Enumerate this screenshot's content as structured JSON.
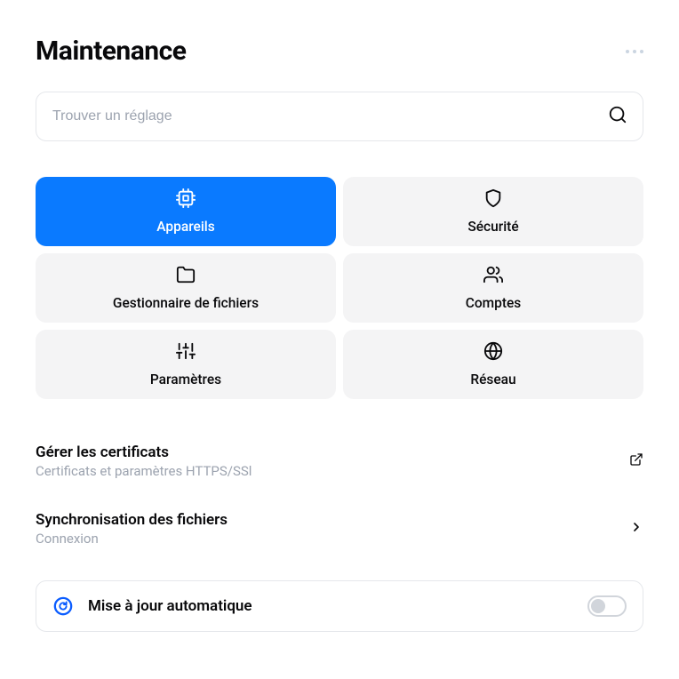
{
  "header": {
    "title": "Maintenance"
  },
  "search": {
    "placeholder": "Trouver un réglage"
  },
  "tiles": [
    {
      "label": "Appareils",
      "icon": "cpu",
      "active": true
    },
    {
      "label": "Sécurité",
      "icon": "shield",
      "active": false
    },
    {
      "label": "Gestionnaire de fichiers",
      "icon": "folder",
      "active": false
    },
    {
      "label": "Comptes",
      "icon": "users",
      "active": false
    },
    {
      "label": "Paramètres",
      "icon": "sliders",
      "active": false
    },
    {
      "label": "Réseau",
      "icon": "globe",
      "active": false
    }
  ],
  "list": [
    {
      "title": "Gérer les certificats",
      "subtitle": "Certificats et paramètres HTTPS/SSl",
      "trailing": "external"
    },
    {
      "title": "Synchronisation des fichiers",
      "subtitle": "Connexion",
      "trailing": "chevron"
    }
  ],
  "update": {
    "label": "Mise à jour automatique",
    "enabled": false
  }
}
